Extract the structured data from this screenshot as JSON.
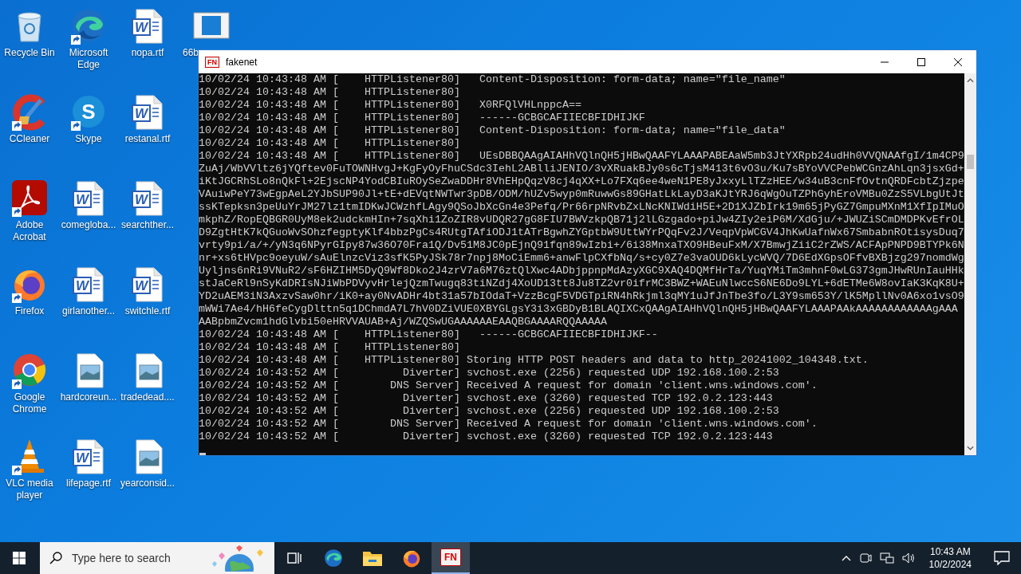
{
  "desktop_icons": [
    {
      "label": "Recycle Bin",
      "kind": "recycle",
      "shortcut": false
    },
    {
      "label": "Microsoft Edge",
      "kind": "edge",
      "shortcut": true
    },
    {
      "label": "nopa.rtf",
      "kind": "word",
      "glyph": "W",
      "shortcut": false
    },
    {
      "label": "66b",
      "kind": "app",
      "shortcut": false
    },
    {
      "label": "CCleaner",
      "kind": "ccleaner",
      "shortcut": true
    },
    {
      "label": "Skype",
      "kind": "skype",
      "glyph": "S",
      "shortcut": true
    },
    {
      "label": "restanal.rtf",
      "kind": "word",
      "glyph": "W",
      "shortcut": false
    },
    {
      "label": "Adobe Acrobat",
      "kind": "acrobat",
      "shortcut": true
    },
    {
      "label": "comegloba...",
      "kind": "word",
      "glyph": "W",
      "shortcut": false
    },
    {
      "label": "searchther...",
      "kind": "word",
      "glyph": "W",
      "shortcut": false
    },
    {
      "label": "Firefox",
      "kind": "firefox",
      "shortcut": true
    },
    {
      "label": "girlanother...",
      "kind": "word",
      "glyph": "W",
      "shortcut": false
    },
    {
      "label": "switchle.rtf",
      "kind": "word",
      "glyph": "W",
      "shortcut": false
    },
    {
      "label": "Google Chrome",
      "kind": "chrome",
      "shortcut": true
    },
    {
      "label": "hardcoreun...",
      "kind": "image",
      "shortcut": false
    },
    {
      "label": "tradedead....",
      "kind": "image",
      "shortcut": false
    },
    {
      "label": "VLC media player",
      "kind": "vlc",
      "shortcut": true
    },
    {
      "label": "lifepage.rtf",
      "kind": "word",
      "glyph": "W",
      "shortcut": false
    },
    {
      "label": "yearconsid...",
      "kind": "image",
      "shortcut": false
    }
  ],
  "window": {
    "title": "fakenet",
    "icon_text": "FN"
  },
  "console": {
    "lines": [
      "10/02/24 10:43:48 AM [    HTTPListener80]   Content-Disposition: form-data; name=\"file_name\"",
      "10/02/24 10:43:48 AM [    HTTPListener80]",
      "10/02/24 10:43:48 AM [    HTTPListener80]   X0RFQlVHLnppcA==",
      "10/02/24 10:43:48 AM [    HTTPListener80]   ------GCBGCAFIIECBFIDHIJKF",
      "10/02/24 10:43:48 AM [    HTTPListener80]   Content-Disposition: form-data; name=\"file_data\"",
      "10/02/24 10:43:48 AM [    HTTPListener80]",
      "10/02/24 10:43:48 AM [    HTTPListener80]   UEsDBBQAAgAIAHhVQlnQH5jHBwQAAFYLAAAPABEAaW5mb3JtYXRpb24udHh0VVQNAAfgI/1m4CP9",
      "ZuAj/WbVVltz6jYQftev0FuTOWNHvgJ+KgFyOyFhuCSdc3IehL2ABlliJENIO/3vXRuakBJy0s6cTjsM413t6vO3u/Ku7sBYoVVCPebWCGnzAhLqn3jsxGd+",
      "iKtJGCRhSLo8nQkFl+2EjscNP4YodCBIuROySeZwaDDHr8VhEHpQqzV8cj4qXX+Lo7FXq6ee4weN1PE8yJxxyLlTZzHEE/w34uB3cnFfOvtnQRDFcbtZjzpe",
      "VAuiwPeY73wEgpAeL2YJbSUP90Jl+tE+dEVqtNWTwr3pDB/ODM/hUZv5wyp0mRuwwGs89GHatLkLayD3aKJtYRJ6qWgOuTZPhGyhEroVMBu0ZzS5VLbgUtJt",
      "ssKTepksn3peUuYrJM27lz1tmIDKwJCWzhfLAgy9QSoJbXcGn4e3Pefq/Pr66rpNRvbZxLNcKNIWdiH5E+2D1XJZbIrk19m65jPyGZ7GmpuMXnM1XfIpIMuO",
      "mkphZ/RopEQBGR0UyM8ek2udckmHIn+7sqXhi1ZoZIR8vUDQR27gG8FIU7BWVzkpQB71j2lLGzgado+piJw4ZIy2eiP6M/XdGju/+JWUZiSCmDMDPKvEfrOL",
      "D9ZgtHtK7kQGuoWvSOhzfegptyKlf4bbzPgCs4RUtgTAfiODJ1tATrBgwhZYGptbW9UttWYrPQqFv2J/VeqpVpWCGV4JhKwUafnWx67SmbabnROtisysDuq7",
      "vrty9pi/a/+/yN3q6NPyrGIpy87w36O70Fra1Q/Dv51M8JC0pEjnQ91fqn89wIzbi+/6i38MnxaTXO9HBeuFxM/X7BmwjZiiC2rZWS/ACFApPNPD9BTYPk6N",
      "nr+xs6tHVpc9oeyuW/sAuElnzcViz3sfK5PyJSk78r7npj8MoCiEmm6+anwFlpCXfbNq/s+cy0Z7e3vaOUD6kLycWVQ/7D6EdXGpsOFfvBXBjzg297nomdWg",
      "Uyljns6nRi9VNuR2/sF6HZIHM5DyQ9Wf8Dko2J4zrV7a6M76ztQlXwc4ADbjppnpMdAzyXGC9XAQ4DQMfHrTa/YuqYMiTm3mhnF0wLG373gmJHwRUnIauHHk",
      "stJaCeRl9nSyKdDRIsNJiWbPDVyvHrlejQzmTwugq83tiNZdj4XoUD13tt8Ju8TZ2vr0ifrMC3BWZ+WAEuNlwccS6NE6Do9LYL+6dETMe6W8ovIaK3KqK8U+",
      "YD2uAEM3iN3AxzvSaw0hr/iK0+ay0NvADHr4bt31a57bIOdaT+VzzBcgF5VDGTpiRN4hRkjml3qMY1uJfJnTbe3fo/L3Y9sm653Y/lK5MpllNv0A6xo1vsO9",
      "mWWi7Ae4/hH6feCygDlttn5q1DChmdA7L7hV0DZiVUE0XBYGLgsY3i3xGBDyB1BLAQIXCxQAAgAIAHhVQlnQH5jHBwQAAFYLAAAPAAkAAAAAAAAAAAAgAAA",
      "AABpbmZvcm1hdGlvbi50eHRVVAUAB+Aj/WZQSwUGAAAAAAEAAQBGAAAARQQAAAAA",
      "10/02/24 10:43:48 AM [    HTTPListener80]   ------GCBGCAFIIECBFIDHIJKF--",
      "10/02/24 10:43:48 AM [    HTTPListener80]",
      "10/02/24 10:43:48 AM [    HTTPListener80] Storing HTTP POST headers and data to http_20241002_104348.txt.",
      "10/02/24 10:43:52 AM [          Diverter] svchost.exe (2256) requested UDP 192.168.100.2:53",
      "10/02/24 10:43:52 AM [        DNS Server] Received A request for domain 'client.wns.windows.com'.",
      "10/02/24 10:43:52 AM [          Diverter] svchost.exe (3260) requested TCP 192.0.2.123:443",
      "10/02/24 10:43:52 AM [          Diverter] svchost.exe (2256) requested UDP 192.168.100.2:53",
      "10/02/24 10:43:52 AM [        DNS Server] Received A request for domain 'client.wns.windows.com'.",
      "10/02/24 10:43:52 AM [          Diverter] svchost.exe (3260) requested TCP 192.0.2.123:443"
    ]
  },
  "taskbar": {
    "search": {
      "placeholder": "Type here to search"
    },
    "apps": [
      {
        "kind": "taskview",
        "selected": false
      },
      {
        "kind": "edge",
        "selected": false
      },
      {
        "kind": "explorer",
        "selected": false
      },
      {
        "kind": "firefox",
        "selected": false
      },
      {
        "kind": "fakenet",
        "label": "FN",
        "selected": true
      }
    ],
    "time": "10:43 AM",
    "date": "10/2/2024"
  }
}
